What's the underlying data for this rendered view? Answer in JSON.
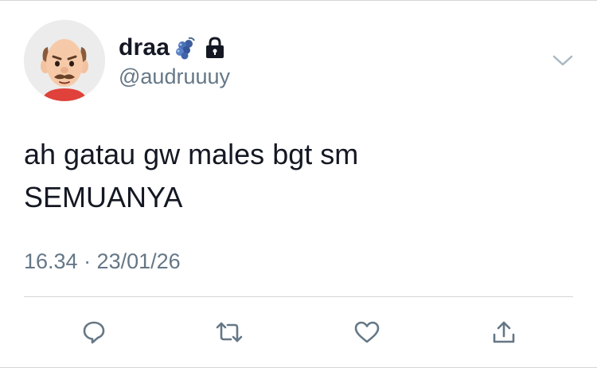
{
  "tweet": {
    "display_name": "draa",
    "name_icons": [
      "blue-grapes-emoji-icon",
      "lock-icon"
    ],
    "handle": "@audruuuy",
    "text_lines": [
      "ah gatau gw males bgt sm",
      "SEMUANYA"
    ],
    "timestamp": "16.34 · 23/01/26"
  },
  "actions": [
    "reply-icon",
    "retweet-icon",
    "like-icon",
    "share-icon"
  ],
  "colors": {
    "text": "#141823",
    "secondary": "#657786",
    "divider": "#d6d6d6",
    "avatar_bg": "#ececec"
  }
}
